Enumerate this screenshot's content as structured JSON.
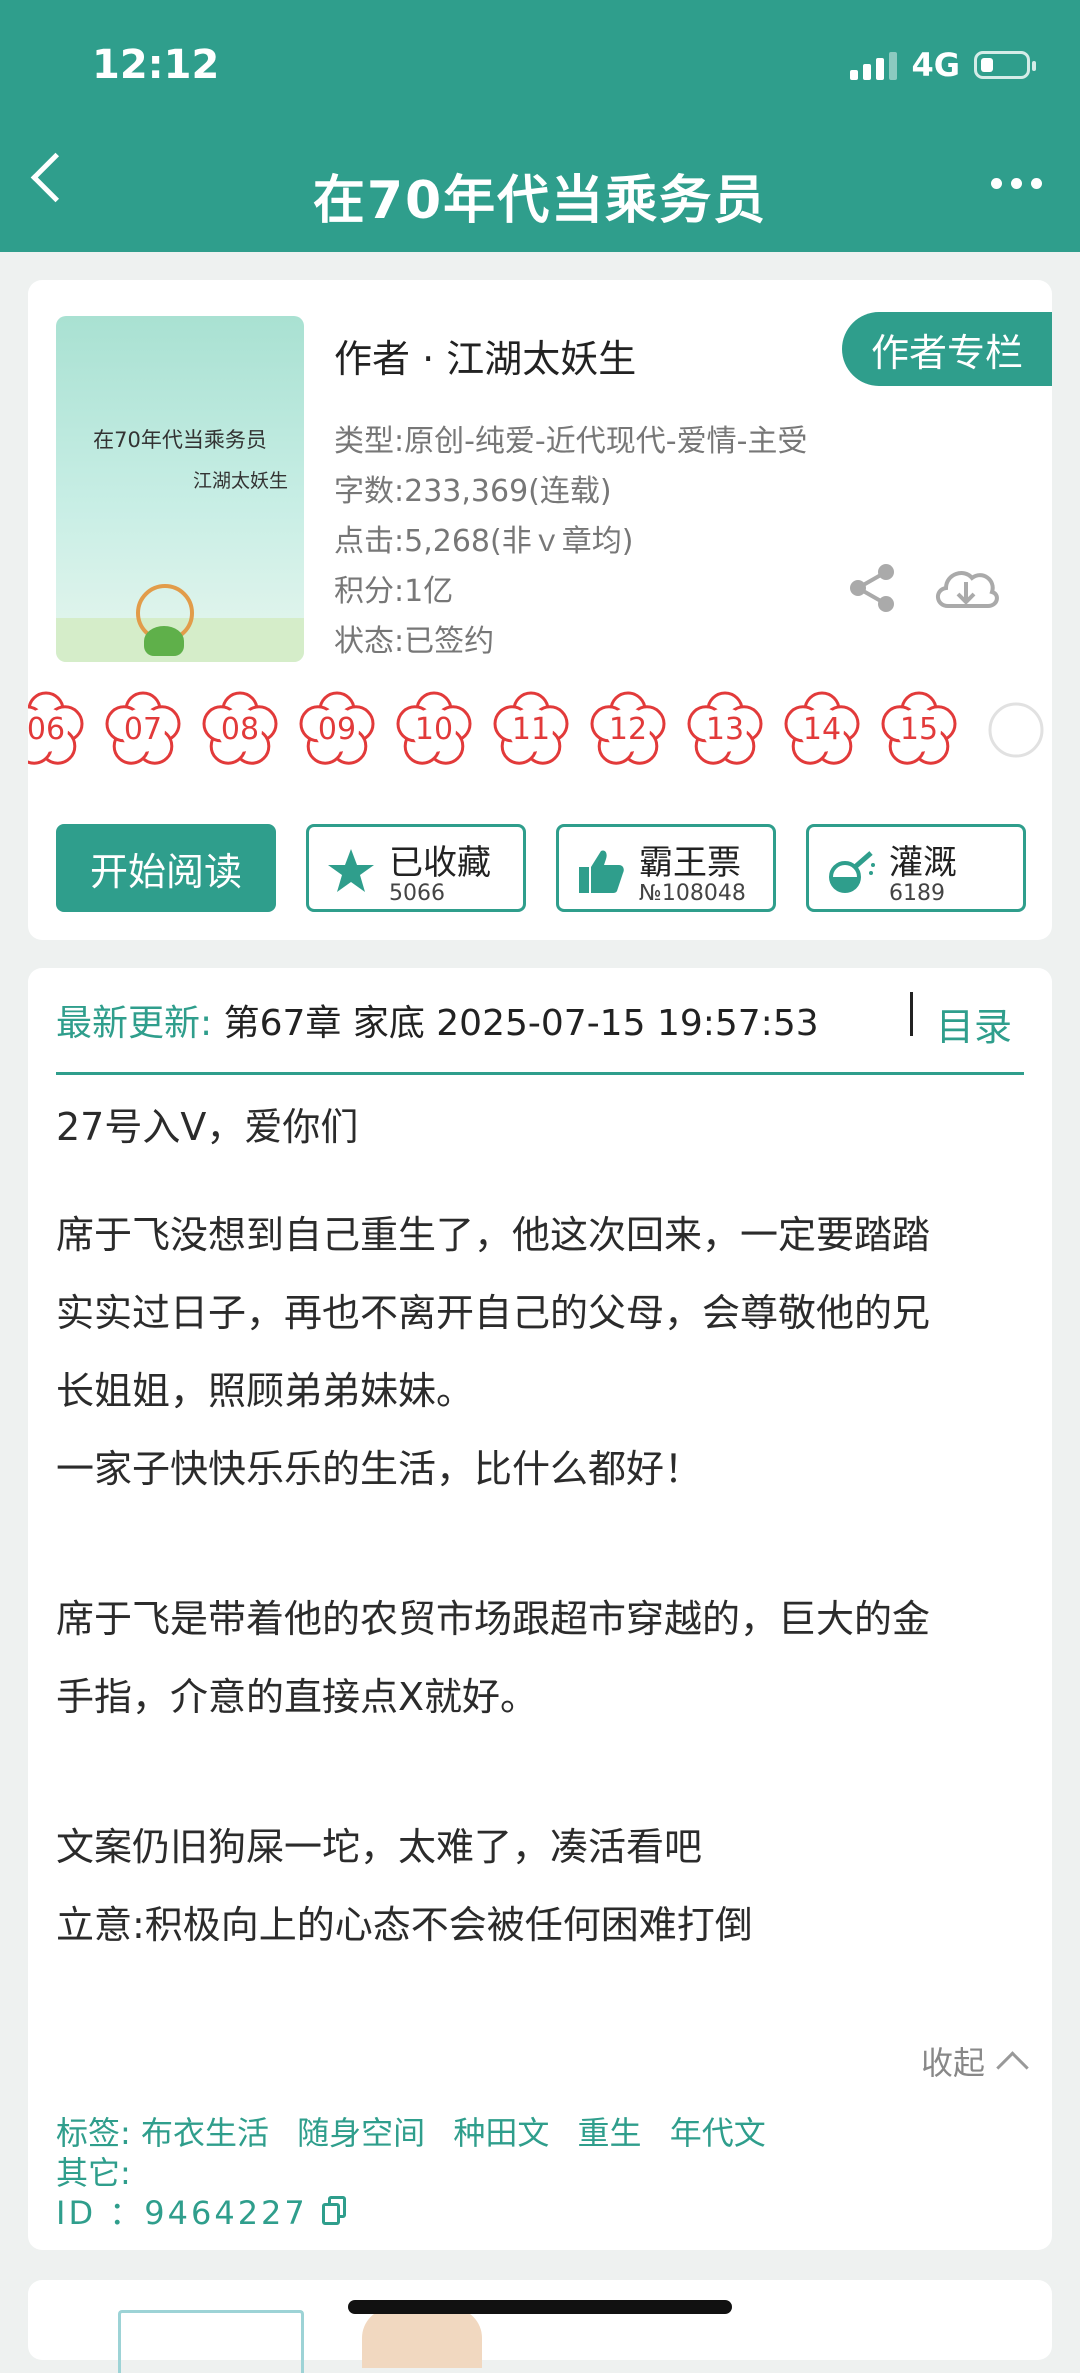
{
  "status": {
    "time": "12:12",
    "network": "4G"
  },
  "header": {
    "title": "在70年代当乘务员"
  },
  "book": {
    "cover_title": "在70年代当乘务员",
    "cover_author": "江湖太妖生",
    "author_line": "作者 · 江湖太妖生",
    "author_column": "作者专栏",
    "type": "类型:原创-纯爱-近代现代-爱情-主受",
    "words": "字数:233,369(连载)",
    "clicks": "点击:5,268(非ｖ章均)",
    "points": "积分:1亿",
    "state": "状态:已签约"
  },
  "flowers": [
    "06",
    "07",
    "08",
    "09",
    "10",
    "11",
    "12",
    "13",
    "14",
    "15"
  ],
  "actions": {
    "read": "开始阅读",
    "collect": {
      "label": "已收藏",
      "count": "5066"
    },
    "vote": {
      "label": "霸王票",
      "count": "№108048"
    },
    "water": {
      "label": "灌溉",
      "count": "6189"
    }
  },
  "update": {
    "label": "最新更新:",
    "text": " 第67章 家底 2025-07-15 19:57:53",
    "toc": "目录"
  },
  "description": [
    "27号入V，爱你们",
    "席于飞没想到自己重生了，他这次回来，一定要踏踏",
    "实实过日子，再也不离开自己的父母，会尊敬他的兄",
    "长姐姐，照顾弟弟妹妹。",
    "一家子快快乐乐的生活，比什么都好！",
    "席于飞是带着他的农贸市场跟超市穿越的，巨大的金",
    "手指，介意的直接点X就好。",
    "文案仍旧狗屎一坨，太难了，凑活看吧",
    "立意:积极向上的心态不会被任何困难打倒"
  ],
  "collapse": "收起",
  "tags": {
    "label": "标签:",
    "items": [
      "布衣生活",
      "随身空间",
      "种田文",
      "重生",
      "年代文"
    ]
  },
  "other": "其它:",
  "id_line": "ID  ：9464227",
  "colors": {
    "accent": "#2f9e8c",
    "flower_red": "#e23a3a"
  }
}
